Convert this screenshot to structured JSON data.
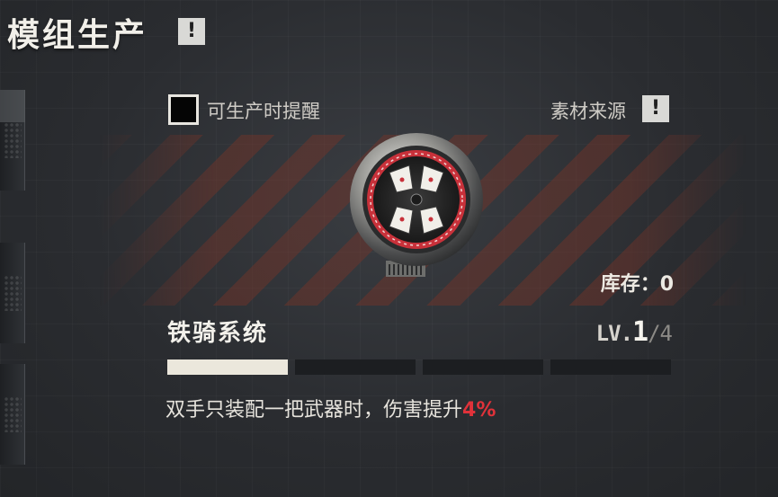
{
  "header": {
    "title": "模组生产",
    "info_symbol": "!"
  },
  "options": {
    "notify_label": "可生产时提醒",
    "notify_checked": false,
    "source_label": "素材来源",
    "source_info_symbol": "!"
  },
  "module": {
    "icon": "iron-knight-module-emblem",
    "stock_text": "库存：0",
    "name": "铁骑系统",
    "level_prefix": "LV.",
    "level_current": "1",
    "level_max": "/4",
    "progress": {
      "filled": 1,
      "total": 4
    },
    "description_text": "双手只装配一把武器时，伤害提升",
    "description_value": "4%"
  },
  "colors": {
    "accent_red": "#e0323a",
    "bar_filled": "#ebe7dc",
    "bar_empty": "#1c1e21",
    "emblem_ring": "#c8313a"
  }
}
